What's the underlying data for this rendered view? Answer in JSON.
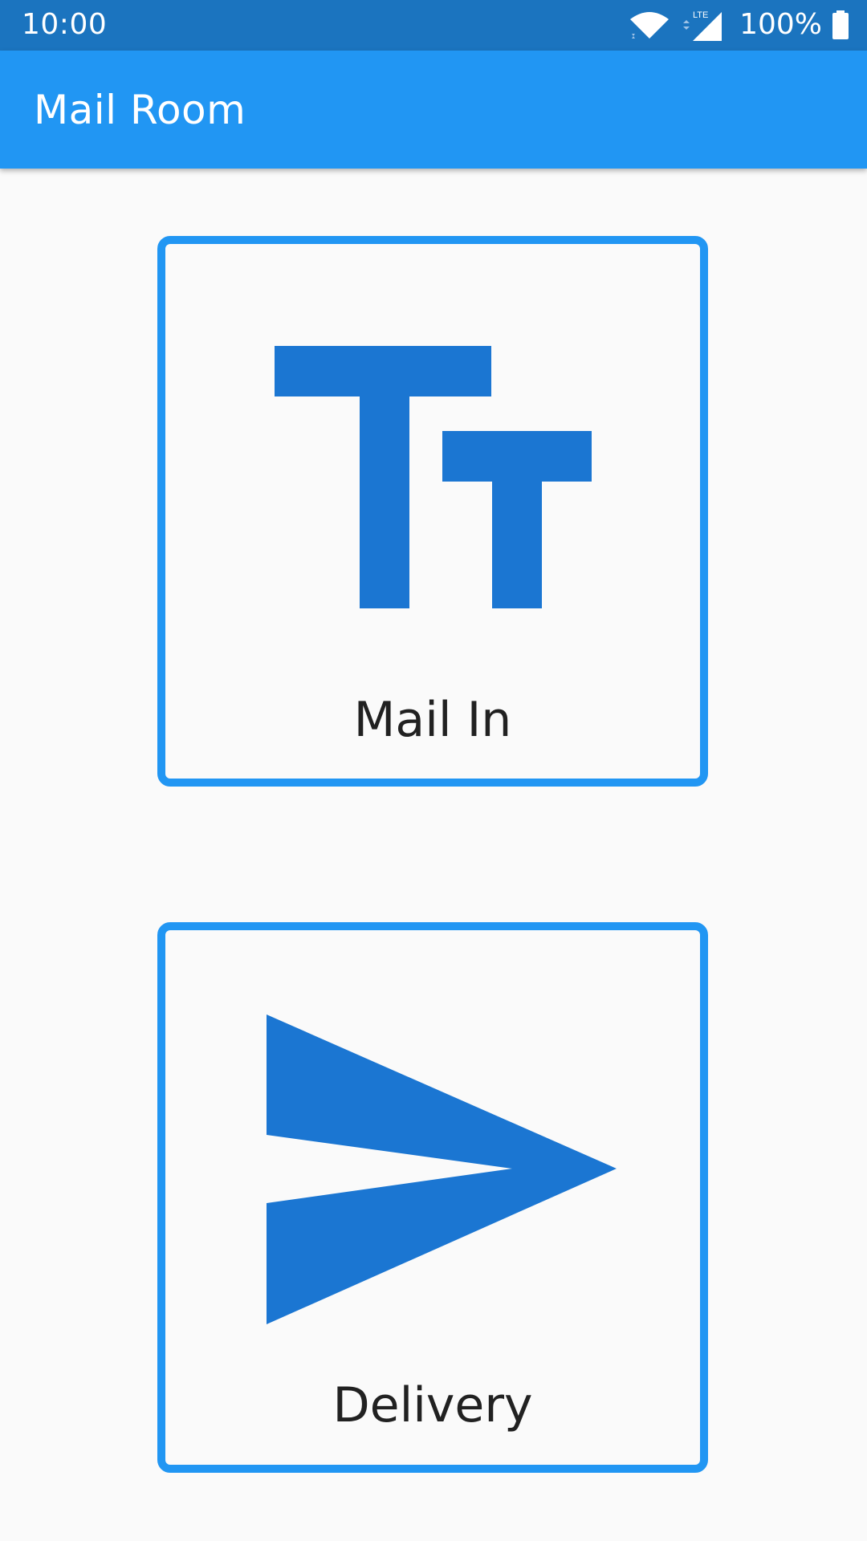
{
  "status_bar": {
    "time": "10:00",
    "network_label": "LTE",
    "battery_percent": "100%",
    "icons": [
      "wifi-icon",
      "lte-signal-icon",
      "battery-full-icon"
    ]
  },
  "app_bar": {
    "title": "Mail Room"
  },
  "tiles": [
    {
      "label": "Mail In",
      "icon": "text-size-icon"
    },
    {
      "label": "Delivery",
      "icon": "send-icon"
    }
  ],
  "colors": {
    "status_bar": "#1b74bf",
    "app_bar": "#2196f3",
    "tile_border": "#2196f3",
    "icon_fill": "#1b76d2",
    "background": "#fafafa",
    "label_text": "#212121"
  }
}
